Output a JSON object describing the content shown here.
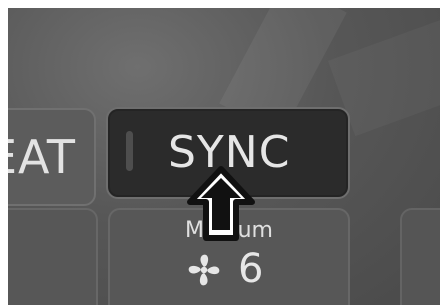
{
  "buttons": {
    "heat_label": "EAT",
    "sync_label": "SYNC",
    "fan_mode_label": "Medium",
    "fan_level": "6"
  },
  "icons": {
    "fan": "fan-icon",
    "pointer": "up-arrow-pointer-icon"
  }
}
